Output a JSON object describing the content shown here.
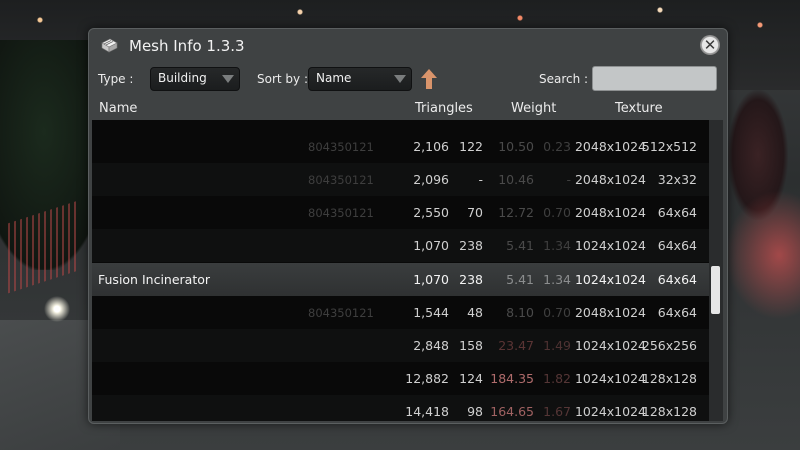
{
  "window": {
    "title": "Mesh Info 1.3.3"
  },
  "toolbar": {
    "type_label": "Type :",
    "type_value": "Building",
    "sort_label": "Sort by :",
    "sort_value": "Name",
    "search_label": "Search :",
    "search_value": ""
  },
  "columns": {
    "name": "Name",
    "triangles": "Triangles",
    "weight": "Weight",
    "texture": "Texture"
  },
  "rows": [
    {
      "name": "",
      "id": "804350121",
      "triangles": "2,106",
      "count": "122",
      "w1": "10.50",
      "w2": "0.23",
      "tex1": "2048x1024",
      "tex2": "512x512"
    },
    {
      "name": "",
      "id": "804350121",
      "triangles": "2,096",
      "count": "-",
      "w1": "10.46",
      "w2": "-",
      "tex1": "2048x1024",
      "tex2": "32x32"
    },
    {
      "name": "",
      "id": "804350121",
      "triangles": "2,550",
      "count": "70",
      "w1": "12.72",
      "w2": "0.70",
      "tex1": "2048x1024",
      "tex2": "64x64"
    },
    {
      "name": "",
      "id": "",
      "triangles": "1,070",
      "count": "238",
      "w1": "5.41",
      "w2": "1.34",
      "tex1": "1024x1024",
      "tex2": "64x64"
    },
    {
      "name": "Fusion Incinerator",
      "id": "",
      "triangles": "1,070",
      "count": "238",
      "w1": "5.41",
      "w2": "1.34",
      "tex1": "1024x1024",
      "tex2": "64x64"
    },
    {
      "name": "",
      "id": "804350121",
      "triangles": "1,544",
      "count": "48",
      "w1": "8.10",
      "w2": "0.70",
      "tex1": "2048x1024",
      "tex2": "64x64"
    },
    {
      "name": "",
      "id": "",
      "triangles": "2,848",
      "count": "158",
      "w1": "23.47",
      "w2": "1.49",
      "tex1": "1024x1024",
      "tex2": "256x256"
    },
    {
      "name": "",
      "id": "",
      "triangles": "12,882",
      "count": "124",
      "w1": "184.35",
      "w2": "1.82",
      "tex1": "1024x1024",
      "tex2": "128x128"
    },
    {
      "name": "",
      "id": "",
      "triangles": "14,418",
      "count": "98",
      "w1": "164.65",
      "w2": "1.67",
      "tex1": "1024x1024",
      "tex2": "128x128"
    }
  ],
  "selected_row_index": 4,
  "colors": {
    "panel": "#3f4243",
    "list_bg": "#090909",
    "selected_row": "#363839",
    "accent_orange": "#e0956a",
    "weight_red": "#b05a5a"
  },
  "icons": {
    "title": "mesh-cube-icon",
    "close": "close-icon",
    "dropdown": "chevron-down-icon",
    "sort": "sort-ascending-arrow-icon"
  }
}
